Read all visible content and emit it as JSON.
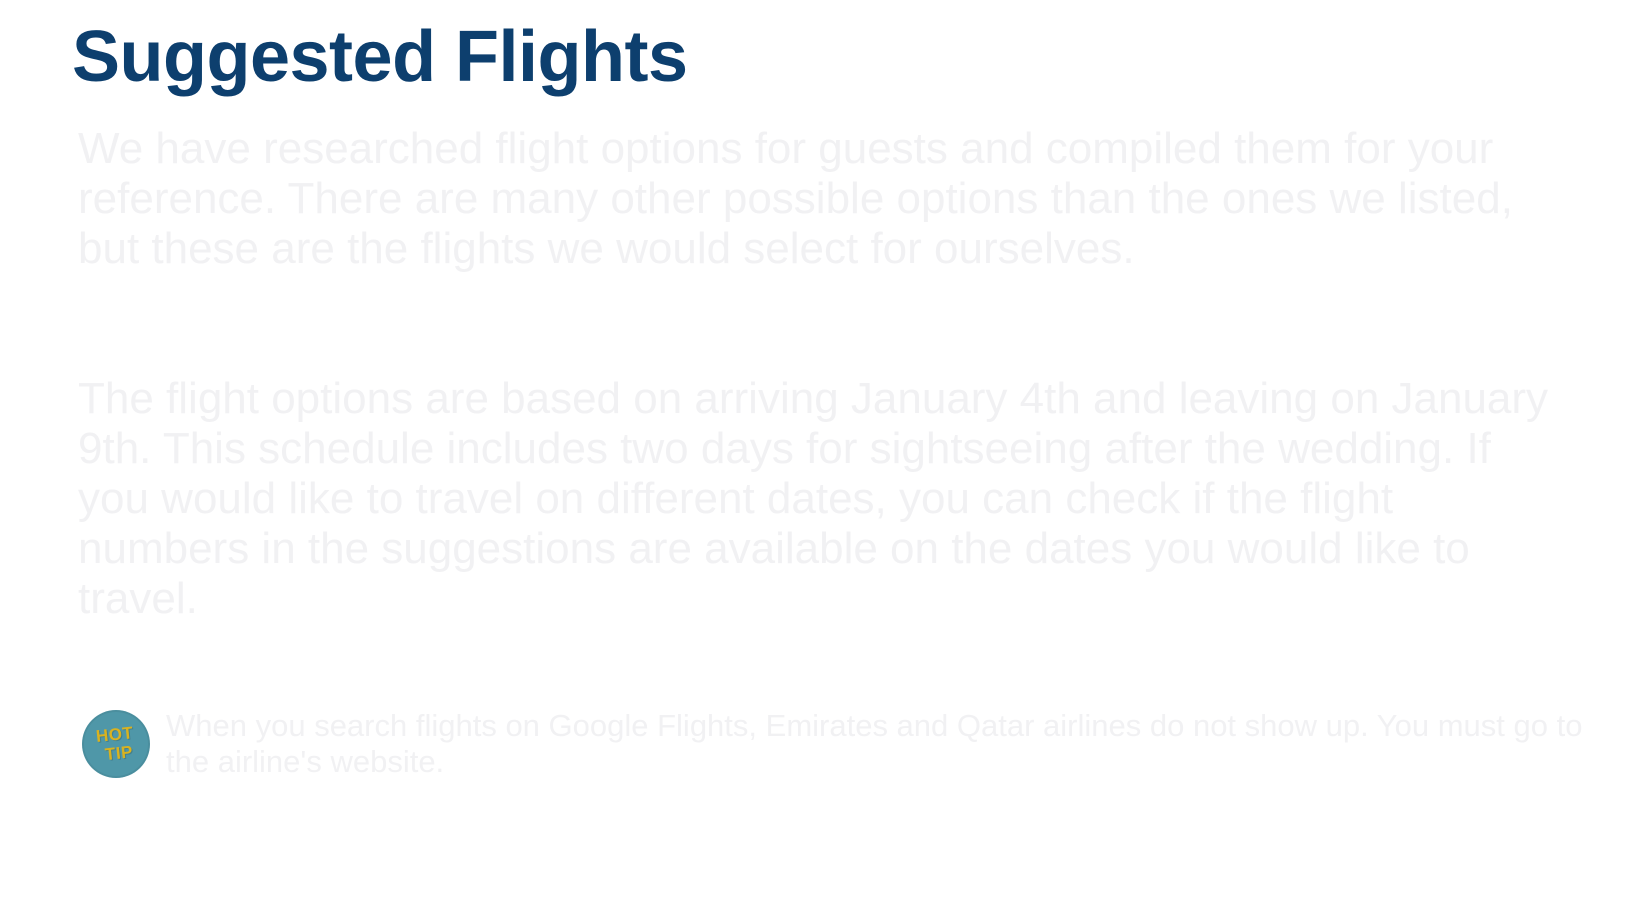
{
  "title": "Suggested Flights",
  "paragraphs": [
    "We have researched flight options for guests and compiled them for your reference. There are many other possible options than the ones we listed, but these are the flights we would select for ourselves.",
    "The flight options are based on arriving January 4th and leaving on January 9th. This schedule includes two days for sightseeing after the wedding. If you would like to travel on different dates, you can check if the flight numbers in the suggestions are available on the dates you would like to travel."
  ],
  "tip": {
    "badge_line_1": "HOT",
    "badge_line_2": "TIP",
    "badge_icon": "hot-tip-badge-icon",
    "text": "When you search flights on Google Flights, Emirates and Qatar airlines do not show up. You must go to the airline's website."
  },
  "colors": {
    "title": "#0d3f6e",
    "body_text": "#f1f1f3",
    "badge_bg": "#4f97a8",
    "badge_text": "#d9b21f",
    "background": "#ffffff"
  }
}
